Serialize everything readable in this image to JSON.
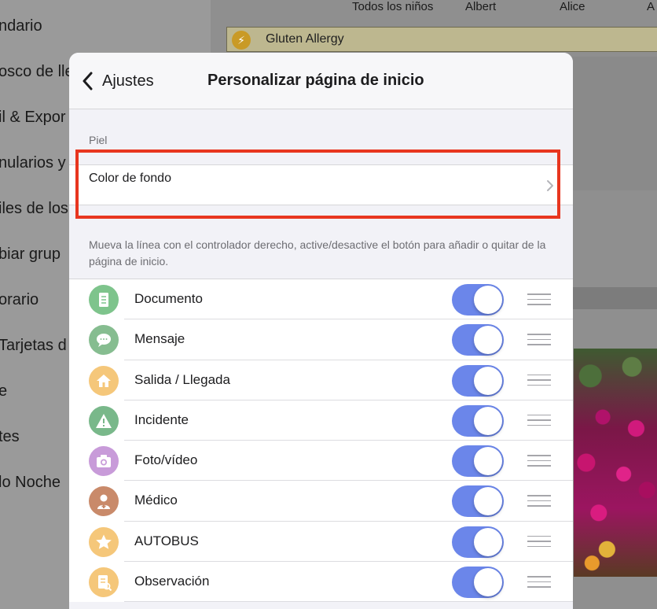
{
  "background": {
    "sidebar_items": [
      "ndario",
      "osco de lle",
      "il & Expor",
      "nularios y",
      "iles de los",
      "biar grup",
      "orario",
      "Tarjetas d",
      "e",
      "tes",
      "lo Noche"
    ],
    "header_columns": [
      "Todos los niños",
      "Albert",
      "Alice",
      "A"
    ],
    "allergy_banner": "Gluten Allergy"
  },
  "nav": {
    "back_label": "Ajustes",
    "title": "Personalizar página de inicio"
  },
  "skin_section": {
    "header": "Piel",
    "background_color_label": "Color de fondo"
  },
  "instructions": "Mueva la línea con el controlador derecho, active/desactive el botón para añadir o quitar de la página de inicio.",
  "items": [
    {
      "label": "Documento",
      "icon": "document-icon",
      "color": "#7ec48c",
      "on": true
    },
    {
      "label": "Mensaje",
      "icon": "message-icon",
      "color": "#86bd90",
      "on": true
    },
    {
      "label": "Salida / Llegada",
      "icon": "home-icon",
      "color": "#f5c77a",
      "on": true
    },
    {
      "label": "Incidente",
      "icon": "warning-icon",
      "color": "#79b88a",
      "on": true
    },
    {
      "label": "Foto/vídeo",
      "icon": "camera-icon",
      "color": "#c89bd9",
      "on": true
    },
    {
      "label": "Médico",
      "icon": "doctor-icon",
      "color": "#c98a6a",
      "on": true
    },
    {
      "label": "AUTOBUS",
      "icon": "star-icon",
      "color": "#f5c77a",
      "on": true
    },
    {
      "label": "Observación",
      "icon": "observation-icon",
      "color": "#f5c77a",
      "on": true
    }
  ],
  "colors": {
    "toggle_on": "#6b86ea",
    "highlight": "#e8361f"
  }
}
